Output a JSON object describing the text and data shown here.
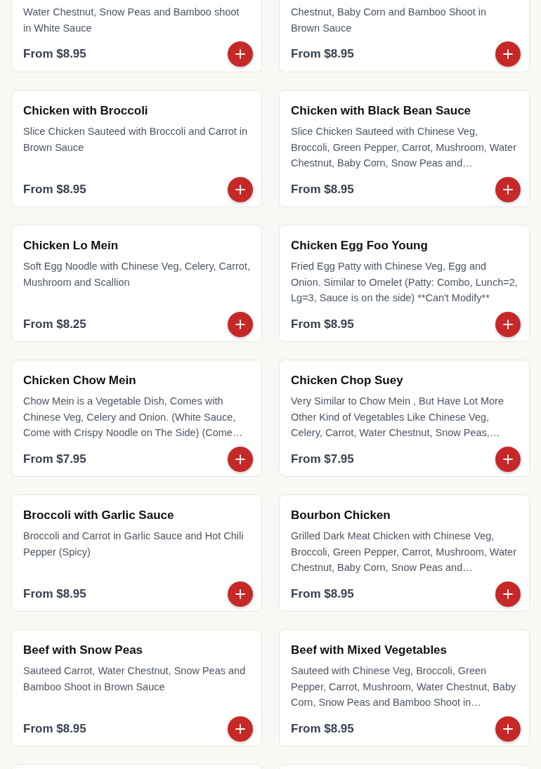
{
  "menu_items": [
    {
      "kind": "partial",
      "description": [
        "Water Chestnut, Snow Peas and Bamboo shoot",
        "in White Sauce"
      ],
      "price": "From $8.95"
    },
    {
      "kind": "partial",
      "description": [
        "Chestnut, Baby Corn and Bamboo Shoot in",
        "Brown Sauce"
      ],
      "price": "From $8.95"
    },
    {
      "kind": "full",
      "name": "Chicken with Broccoli",
      "description": "Slice Chicken Sauteed with Broccoli and Carrot in Brown Sauce",
      "price": "From $8.95"
    },
    {
      "kind": "full",
      "name": "Chicken with Black Bean Sauce",
      "description": "Slice Chicken Sauteed with Chinese Veg, Broccoli, Green Pepper, Carrot, Mushroom, Water Chestnut, Baby Corn, Snow Peas and…",
      "price": "From $8.95"
    },
    {
      "kind": "full",
      "name": "Chicken Lo Mein",
      "description": "Soft Egg Noodle with Chinese Veg, Celery, Carrot, Mushroom and Scallion",
      "price": "From $8.25"
    },
    {
      "kind": "full",
      "name": "Chicken Egg Foo Young",
      "description": "Fried Egg Patty with Chinese Veg, Egg and Onion. Similar to Omelet (Patty: Combo, Lunch=2, Lg=3, Sauce is on the side) **Can't Modify**",
      "price": "From $8.95"
    },
    {
      "kind": "full",
      "name": "Chicken Chow Mein",
      "description": "Chow Mein is a Vegetable Dish, Comes with Chinese Veg, Celery and Onion. (White Sauce, Come with Crispy Noodle on The Side) (Come…",
      "price": "From $7.95"
    },
    {
      "kind": "full",
      "name": "Chicken Chop Suey",
      "description": "Very Similar to Chow Mein , But Have Lot More Other Kind of Vegetables Like Chinese Veg, Celery, Carrot, Water Chestnut, Snow Peas,…",
      "price": "From $7.95"
    },
    {
      "kind": "full",
      "name": "Broccoli with Garlic Sauce",
      "description": "Broccoli and Carrot in Garlic Sauce and Hot Chili Pepper (Spicy)",
      "price": "From $8.95"
    },
    {
      "kind": "full",
      "name": "Bourbon Chicken",
      "description": "Grilled Dark Meat Chicken with Chinese Veg, Broccoli, Green Pepper, Carrot, Mushroom, Water Chestnut, Baby Corn, Snow Peas and…",
      "price": "From $8.95"
    },
    {
      "kind": "full",
      "name": "Beef with Snow Peas",
      "description": "Sauteed Carrot, Water Chestnut, Snow Peas and Bamboo Shoot in Brown Sauce",
      "price": "From $8.95"
    },
    {
      "kind": "full",
      "name": "Beef with Mixed Vegetables",
      "description": "Sauteed with Chinese Veg, Broccoli, Green Pepper, Carrot, Mushroom, Water Chestnut, Baby Corn, Snow Peas and Bamboo Shoot in…",
      "price": "From $8.95"
    },
    {
      "kind": "edge"
    },
    {
      "kind": "edge"
    }
  ]
}
